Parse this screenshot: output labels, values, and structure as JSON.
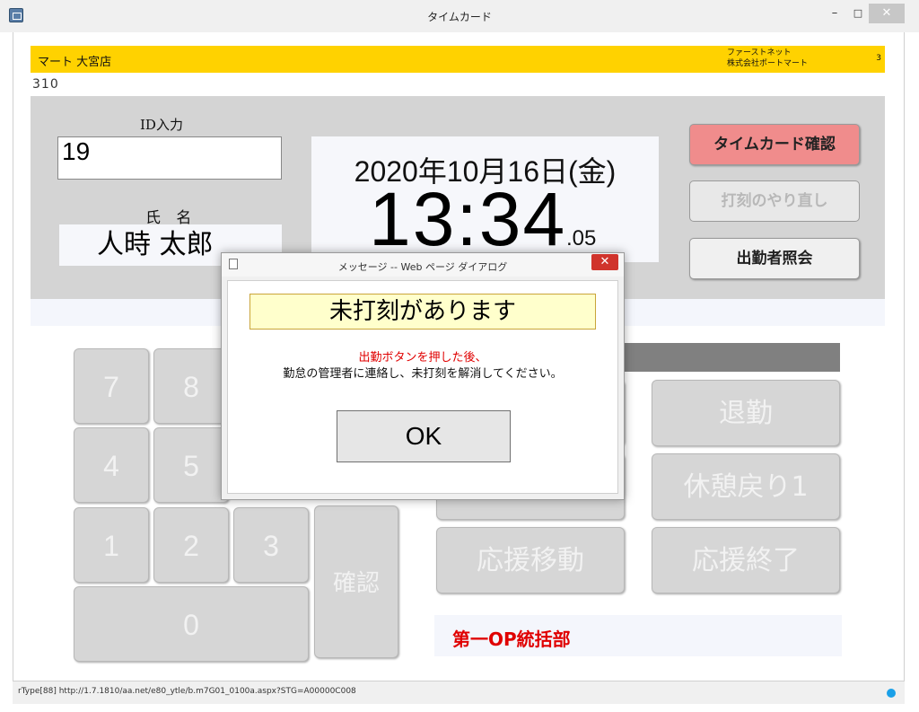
{
  "window": {
    "title": "タイムカード",
    "minimize_glyph": "–",
    "maximize_glyph": "□",
    "close_glyph": "✕"
  },
  "banner": {
    "store_name": "マート 大宮店",
    "company_line1": "ファーストネット",
    "company_line2": "株式会社ポートマート",
    "right_number": "3"
  },
  "store_code": "310",
  "id_entry": {
    "label": "ID入力",
    "value": "19"
  },
  "employee": {
    "label": "氏 名",
    "name": "人時 太郎"
  },
  "clock": {
    "date": "2020年10月16日(金)",
    "time": "13:34",
    "seconds": ".05"
  },
  "side_buttons": {
    "timecard": "タイムカード確認",
    "redo": "打刻のやり直し",
    "inquiry": "出勤者照会"
  },
  "keypad": {
    "k7": "7",
    "k8": "8",
    "k4": "4",
    "k5": "5",
    "k1": "1",
    "k2": "2",
    "k3": "3",
    "k0": "0",
    "confirm": "確認"
  },
  "actions": {
    "leave": "退勤",
    "break_return": "休憩戻り1",
    "support_move": "応援移動",
    "support_end": "応援終了"
  },
  "department": "第一OP統括部",
  "statusbar": {
    "url": "rType[88] http://1.7.1810/aa.net/e80_ytle/b.m7G01_0100a.aspx?STG=A00000C008"
  },
  "dialog": {
    "title": "メッセージ -- Web ページ ダイアログ",
    "close_glyph": "✕",
    "heading": "未打刻があります",
    "line1": "出勤ボタンを押した後、",
    "line2": "勤怠の管理者に連絡し、未打刻を解消してください。",
    "ok": "OK"
  },
  "colors": {
    "banner": "#ffd200",
    "panel": "#d4d4d4",
    "timecard_button": "#f08c8c",
    "department_text": "#e00000",
    "dialog_heading_bg": "#ffffcc"
  }
}
